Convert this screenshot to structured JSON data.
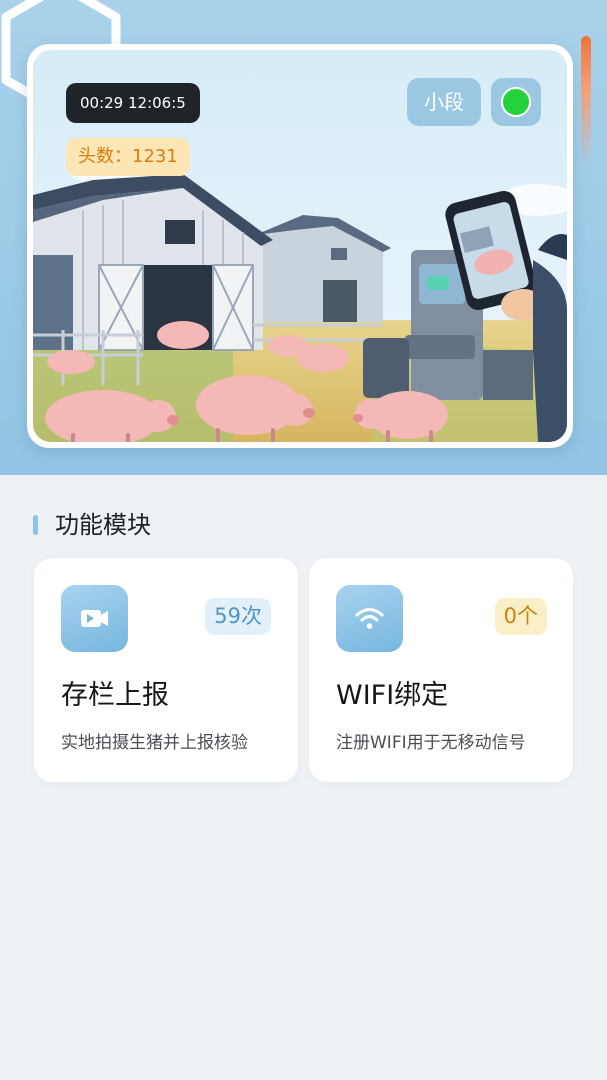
{
  "hero": {
    "timestamp": "00:29 12:06:5",
    "head_count": "头数：1231",
    "user_name": "小段",
    "status_color": "#23d23a"
  },
  "section": {
    "title": "功能模块"
  },
  "modules": [
    {
      "icon": "video-upload-icon",
      "badge": "59次",
      "title": "存栏上报",
      "description": "实地拍摄生猪并上报核验",
      "badge_color": "#4d95c9"
    },
    {
      "icon": "wifi-icon",
      "badge": "0个",
      "title": "WIFI绑定",
      "description": "注册WIFI用于无移动信号",
      "badge_color": "#c9820e"
    }
  ],
  "colors": {
    "accent": "#8fc3e6",
    "header_bg": "#a9d2ea",
    "page_bg": "#eef2f6"
  }
}
